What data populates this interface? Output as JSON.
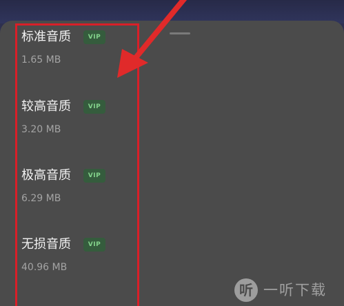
{
  "sheet": {
    "items": [
      {
        "name": "标准音质",
        "badge": "VIP",
        "size": "1.65 MB"
      },
      {
        "name": "较高音质",
        "badge": "VIP",
        "size": "3.20 MB"
      },
      {
        "name": "极高音质",
        "badge": "VIP",
        "size": "6.29 MB"
      },
      {
        "name": "无损音质",
        "badge": "VIP",
        "size": "40.96 MB"
      }
    ]
  },
  "annotation": {
    "highlight_color": "#d91f28"
  },
  "watermark": {
    "mark": "听",
    "text": "一听下载"
  }
}
